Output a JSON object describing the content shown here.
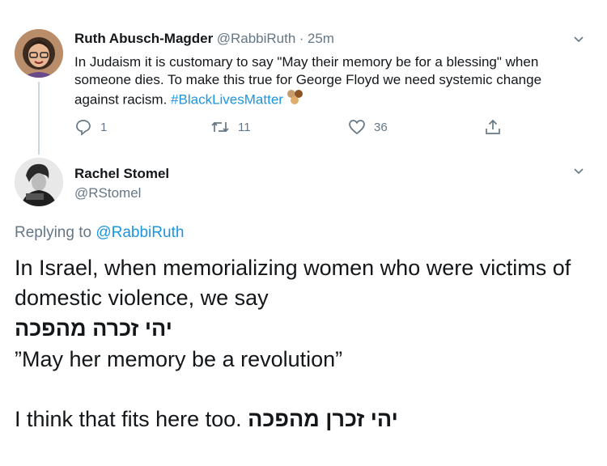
{
  "tweet1": {
    "author_name": "Ruth Abusch-Magder",
    "handle": "@RabbiRuth",
    "separator": "·",
    "time": "25m",
    "text_pre": "In Judaism it is customary to say \"May their memory be for a blessing\" when someone dies. To make this true for George Floyd we need systemic change against racism. ",
    "hashtag": "#BlackLivesMatter",
    "stats": {
      "replies": "1",
      "retweets": "11",
      "likes": "36"
    },
    "colors": {
      "hashtag": "#1b95e0",
      "muted": "#657786",
      "thread_line": "#ccd6dd"
    }
  },
  "tweet2": {
    "author_name": "Rachel Stomel",
    "handle": "@RStomel",
    "replying_prefix": "Replying to",
    "replying_handle": "@RabbiRuth",
    "line1": "In Israel, when memorializing women who were victims of domestic violence, we say",
    "hebrew1": "יהי זכרה מהפכה",
    "quote": "”May her memory be a revolution”",
    "final_text": "I think that fits here too. ",
    "final_hebrew": "יהי זכרן מהפכה"
  },
  "icons": [
    "chevron-down-icon",
    "reply-icon",
    "retweet-icon",
    "like-icon",
    "share-icon",
    "hand-emoji-icon"
  ]
}
